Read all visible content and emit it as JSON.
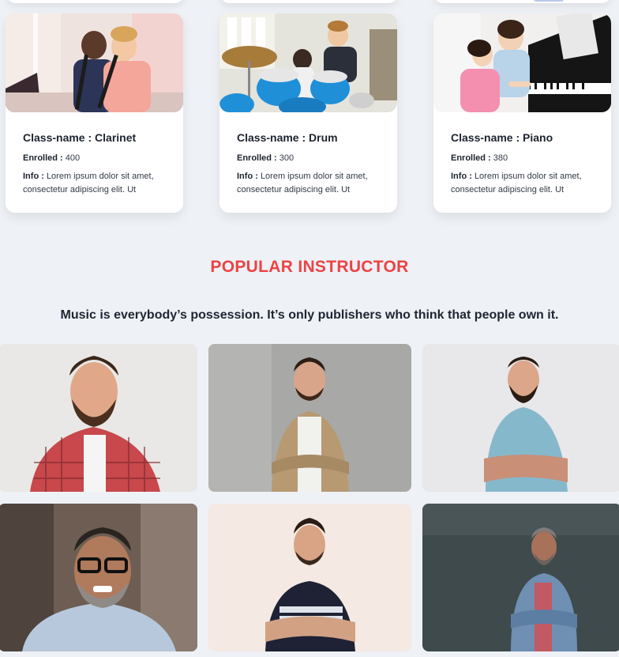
{
  "classes": [
    {
      "title": "Class-name : Clarinet",
      "enrolled_label": "Enrolled : ",
      "enrolled": "400",
      "info_label": "Info : ",
      "info": "Lorem ipsum dolor sit amet, consectetur adipiscing elit. Ut"
    },
    {
      "title": "Class-name : Drum",
      "enrolled_label": "Enrolled : ",
      "enrolled": "300",
      "info_label": "Info : ",
      "info": "Lorem ipsum dolor sit amet, consectetur adipiscing elit. Ut"
    },
    {
      "title": "Class-name : Piano",
      "enrolled_label": "Enrolled : ",
      "enrolled": "380",
      "info_label": "Info : ",
      "info": "Lorem ipsum dolor sit amet, consectetur adipiscing elit. Ut"
    }
  ],
  "instructors_section": {
    "title": "POPULAR INSTRUCTOR",
    "quote": "Music is everybody’s possession. It’s only publishers who think that people own it."
  },
  "colors": {
    "page_bg": "#eef1f6",
    "accent_title": "#ec4343",
    "card_bg": "#ffffff"
  }
}
